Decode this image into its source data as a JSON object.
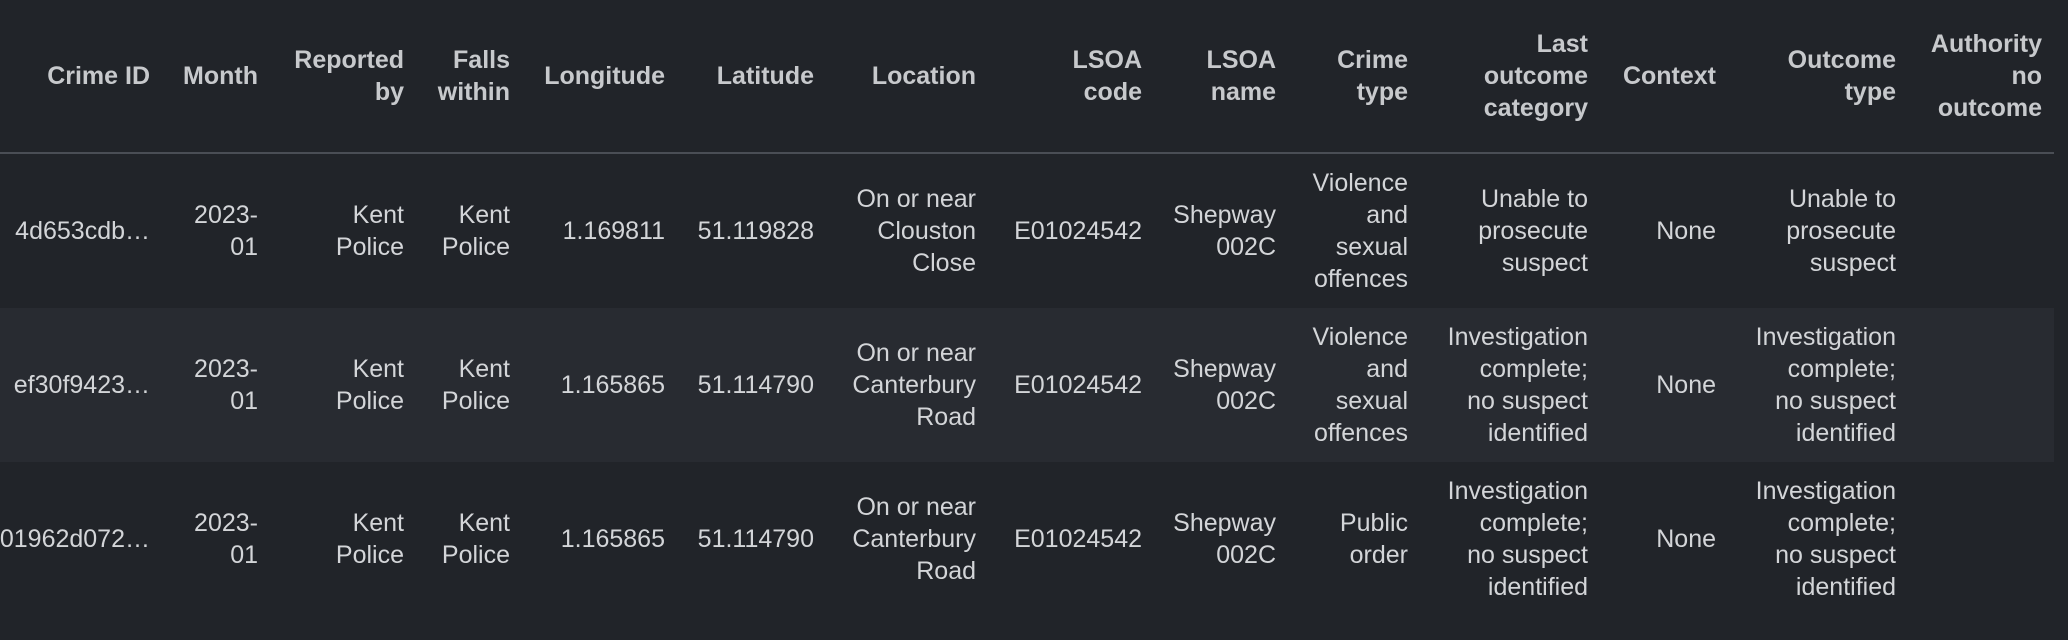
{
  "table": {
    "headers": [
      "Crime ID",
      "Month",
      "Reported\nby",
      "Falls\nwithin",
      "Longitude",
      "Latitude",
      "Location",
      "LSOA\ncode",
      "LSOA\nname",
      "Crime\ntype",
      "Last\noutcome\ncategory",
      "Context",
      "Outcome\ntype",
      "Authority\nno\noutcome"
    ],
    "rows": [
      [
        "4d653cdb…",
        "2023-\n01",
        "Kent\nPolice",
        "Kent\nPolice",
        "1.169811",
        "51.119828",
        "On or near\nClouston\nClose",
        "E01024542",
        "Shepway\n002C",
        "Violence\nand\nsexual\noffences",
        "Unable to\nprosecute\nsuspect",
        "None",
        "Unable to\nprosecute\nsuspect",
        ""
      ],
      [
        "ef30f9423…",
        "2023-\n01",
        "Kent\nPolice",
        "Kent\nPolice",
        "1.165865",
        "51.114790",
        "On or near\nCanterbury\nRoad",
        "E01024542",
        "Shepway\n002C",
        "Violence\nand\nsexual\noffences",
        "Investigation\ncomplete;\nno suspect\nidentified",
        "None",
        "Investigation\ncomplete;\nno suspect\nidentified",
        ""
      ],
      [
        "01962d072…",
        "2023-\n01",
        "Kent\nPolice",
        "Kent\nPolice",
        "1.165865",
        "51.114790",
        "On or near\nCanterbury\nRoad",
        "E01024542",
        "Shepway\n002C",
        "Public\norder",
        "Investigation\ncomplete;\nno suspect\nidentified",
        "None",
        "Investigation\ncomplete;\nno suspect\nidentified",
        ""
      ]
    ]
  }
}
